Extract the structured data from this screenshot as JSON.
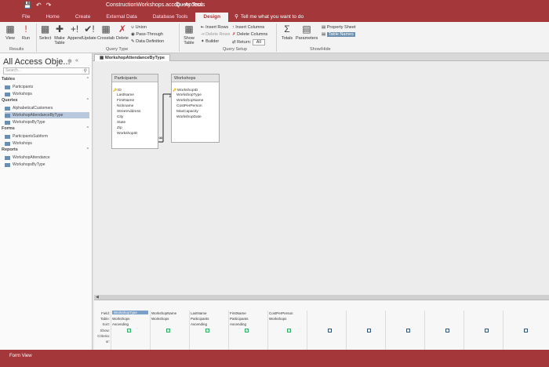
{
  "titlebar": {
    "title": "ConstructionWorkshops.accdb - Access",
    "context": "Query Tools"
  },
  "tabs": [
    "File",
    "Home",
    "Create",
    "External Data",
    "Database Tools",
    "Design"
  ],
  "tellme": "Tell me what you want to do",
  "ribbon": {
    "results": {
      "view": "View",
      "run": "Run",
      "label": "Results"
    },
    "query_type": {
      "select": "Select",
      "make_table": "Make Table",
      "append": "Append",
      "update": "Update",
      "crosstab": "Crosstab",
      "delete": "Delete",
      "union": "Union",
      "pass_through": "Pass-Through",
      "data_definition": "Data Definition",
      "label": "Query Type"
    },
    "show_table": "Show Table",
    "setup": {
      "insert_rows": "Insert Rows",
      "delete_rows": "Delete Rows",
      "builder": "Builder",
      "insert_columns": "Insert Columns",
      "delete_columns": "Delete Columns",
      "return": "Return:",
      "return_value": "All",
      "label": "Query Setup"
    },
    "totals": "Totals",
    "parameters": "Parameters",
    "property_sheet": "Property Sheet",
    "table_names": "Table Names",
    "showhide_label": "Show/Hide"
  },
  "nav": {
    "title": "All Access Obje...",
    "search_placeholder": "Search...",
    "tables_label": "Tables",
    "tables": [
      "Participants",
      "Workshops"
    ],
    "queries_label": "Queries",
    "queries": [
      "AlphabeticalCustomers",
      "WorkshopAttendanceByType",
      "WorkshopsByType"
    ],
    "forms_label": "Forms",
    "forms": [
      "ParticipantsSubform",
      "Workshops"
    ],
    "reports_label": "Reports",
    "reports": [
      "WorkshopAttendance",
      "WorkshopsByType"
    ]
  },
  "doc_tab": "WorkshopAttendanceByType",
  "tables": {
    "participants": {
      "name": "Participants",
      "fields": [
        "ID",
        "LastName",
        "FirstName",
        "Nickname",
        "StreetAddress",
        "City",
        "State",
        "Zip",
        "WorkshopID"
      ]
    },
    "workshops": {
      "name": "Workshops",
      "fields": [
        "WorkshopID",
        "WorkshopType",
        "WorkshopName",
        "CostPerPerson",
        "MaxCapacity",
        "WorkshopDate"
      ]
    }
  },
  "grid": {
    "row_labels": [
      "Field:",
      "Table:",
      "Sort:",
      "Show:",
      "Criteria:",
      "or:"
    ],
    "columns": [
      {
        "field": "WorkshopType",
        "table": "Workshops",
        "sort": "Ascending",
        "show": true
      },
      {
        "field": "WorkshopName",
        "table": "Workshops",
        "sort": "",
        "show": true
      },
      {
        "field": "LastName",
        "table": "Participants",
        "sort": "Ascending",
        "show": true
      },
      {
        "field": "FirstName",
        "table": "Participants",
        "sort": "Ascending",
        "show": true
      },
      {
        "field": "CostPerPerson",
        "table": "Workshops",
        "sort": "",
        "show": true
      },
      {
        "field": "",
        "table": "",
        "sort": "",
        "show": false
      },
      {
        "field": "",
        "table": "",
        "sort": "",
        "show": false
      },
      {
        "field": "",
        "table": "",
        "sort": "",
        "show": false
      },
      {
        "field": "",
        "table": "",
        "sort": "",
        "show": false
      },
      {
        "field": "",
        "table": "",
        "sort": "",
        "show": false
      },
      {
        "field": "",
        "table": "",
        "sort": "",
        "show": false
      }
    ]
  },
  "status": "Form View"
}
